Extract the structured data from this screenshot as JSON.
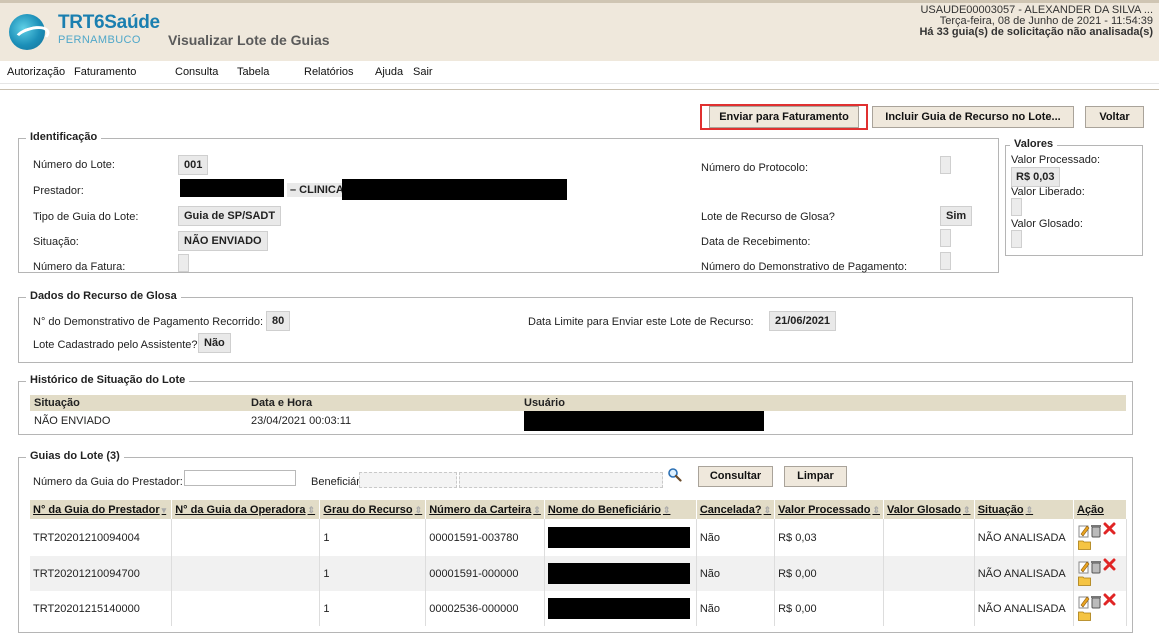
{
  "header": {
    "logo_name": "TRT6Saúde",
    "logo_sub": "PERNAMBUCO",
    "page_title": "Visualizar Lote de Guias",
    "user": "USAUDE00003057 - ALEXANDER DA SILVA ...",
    "datetime": "Terça-feira, 08 de Junho de 2021 - 11:54:39",
    "pending": "Há 33 guia(s) de solicitação não analisada(s)"
  },
  "menu": [
    "Autorização",
    "Faturamento",
    "Consulta",
    "Tabela",
    "Relatórios",
    "Ajuda",
    "Sair"
  ],
  "actions": {
    "send": "Enviar para Faturamento",
    "include": "Incluir Guia de Recurso no Lote...",
    "back": "Voltar"
  },
  "identificacao": {
    "legend": "Identificação",
    "numero_lote_label": "Número do Lote:",
    "numero_lote": "001",
    "prestador_label": "Prestador:",
    "prestador_mid": "– CLINICA",
    "tipo_label": "Tipo de Guia do Lote:",
    "tipo": "Guia de SP/SADT",
    "situacao_label": "Situação:",
    "situacao": "NÃO ENVIADO",
    "fatura_label": "Número da Fatura:",
    "protocolo_label": "Número do Protocolo:",
    "recurso_label": "Lote de Recurso de Glosa?",
    "recurso": "Sim",
    "recebimento_label": "Data de Recebimento:",
    "demonstrativo_label": "Número do Demonstrativo de Pagamento:"
  },
  "valores": {
    "legend": "Valores",
    "processado_label": "Valor Processado:",
    "processado": "R$ 0,03",
    "liberado_label": "Valor Liberado:",
    "glosado_label": "Valor Glosado:"
  },
  "recurso": {
    "legend": "Dados do Recurso de Glosa",
    "demonstrativo_label": "N° do Demonstrativo de Pagamento Recorrido:",
    "demonstrativo": "80",
    "data_limite_label": "Data Limite para Enviar este Lote de Recurso:",
    "data_limite": "21/06/2021",
    "assistente_label": "Lote Cadastrado pelo Assistente?",
    "assistente": "Não"
  },
  "historico": {
    "legend": "Histórico de Situação do Lote",
    "headers": [
      "Situação",
      "Data e Hora",
      "Usuário"
    ],
    "row": [
      "NÃO ENVIADO",
      "23/04/2021 00:03:11"
    ]
  },
  "guias": {
    "legend": "Guias do Lote (3)",
    "prestador_label": "Número da Guia do Prestador:",
    "beneficiario_label": "Beneficiário:",
    "consultar": "Consultar",
    "limpar": "Limpar",
    "headers": [
      "N° da Guia do Prestador",
      "N° da Guia da Operadora",
      "Grau do Recurso",
      "Número da Carteira",
      "Nome do Beneficiário",
      "Cancelada?",
      "Valor Processado",
      "Valor Glosado",
      "Situação",
      "Ação"
    ],
    "rows": [
      {
        "prestador": "TRT20201210094004",
        "operadora": "",
        "grau": "1",
        "carteira": "00001591-003780",
        "cancelada": "Não",
        "valor": "R$ 0,03",
        "glosado": "",
        "situacao": "NÃO ANALISADA"
      },
      {
        "prestador": "TRT20201210094700",
        "operadora": "",
        "grau": "1",
        "carteira": "00001591-000000",
        "cancelada": "Não",
        "valor": "R$ 0,00",
        "glosado": "",
        "situacao": "NÃO ANALISADA"
      },
      {
        "prestador": "TRT20201215140000",
        "operadora": "",
        "grau": "1",
        "carteira": "00002536-000000",
        "cancelada": "Não",
        "valor": "R$ 0,00",
        "glosado": "",
        "situacao": "NÃO ANALISADA"
      }
    ]
  },
  "colors": {
    "header_bg": "#efe8dc",
    "table_header_bg": "#e2dcc7",
    "highlight": "#e03030",
    "brand": "#1a7fb0"
  },
  "icons": [
    "edit-icon",
    "delete-icon",
    "remove-icon",
    "folder-icon",
    "search-icon"
  ]
}
